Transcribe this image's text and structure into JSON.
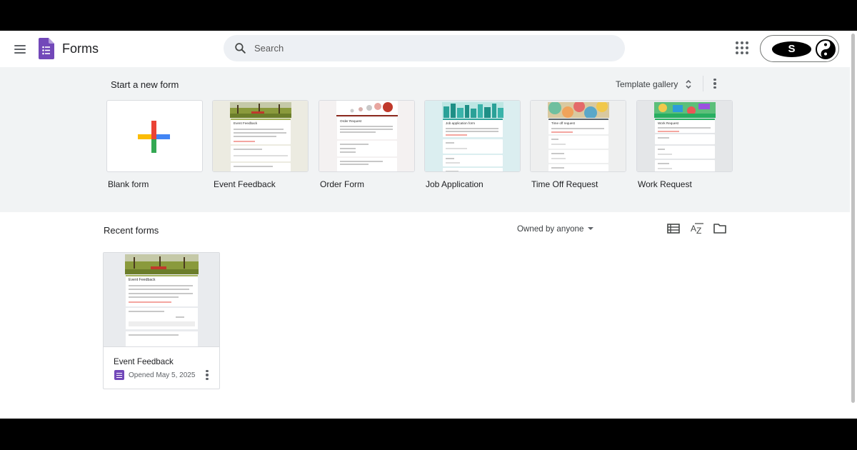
{
  "header": {
    "app_name": "Forms",
    "search_placeholder": "Search",
    "account_initial": "S"
  },
  "templates": {
    "section_title": "Start a new form",
    "gallery_label": "Template gallery",
    "items": [
      {
        "label": "Blank form",
        "mini_title": ""
      },
      {
        "label": "Event Feedback",
        "mini_title": "Event Feedback"
      },
      {
        "label": "Order Form",
        "mini_title": "Order Request"
      },
      {
        "label": "Job Application",
        "mini_title": "Job application form"
      },
      {
        "label": "Time Off Request",
        "mini_title": "Time off request"
      },
      {
        "label": "Work Request",
        "mini_title": "Work Request"
      }
    ]
  },
  "recent": {
    "section_title": "Recent forms",
    "owner_filter": "Owned by anyone",
    "forms": [
      {
        "name": "Event Feedback",
        "opened": "Opened May 5, 2025",
        "mini_title": "Event Feedback"
      }
    ]
  },
  "colors": {
    "forms_purple": "#7248b9",
    "page_bg": "#ffffff",
    "template_bg": "#f1f3f4",
    "search_bg": "#edf0f4"
  },
  "icons": [
    "menu-icon",
    "forms-logo-icon",
    "search-icon",
    "apps-grid-icon",
    "account-avatar",
    "unfold-icon",
    "more-vert-icon",
    "plus-icon",
    "list-view-icon",
    "sort-az-icon",
    "folder-icon",
    "forms-file-icon"
  ]
}
